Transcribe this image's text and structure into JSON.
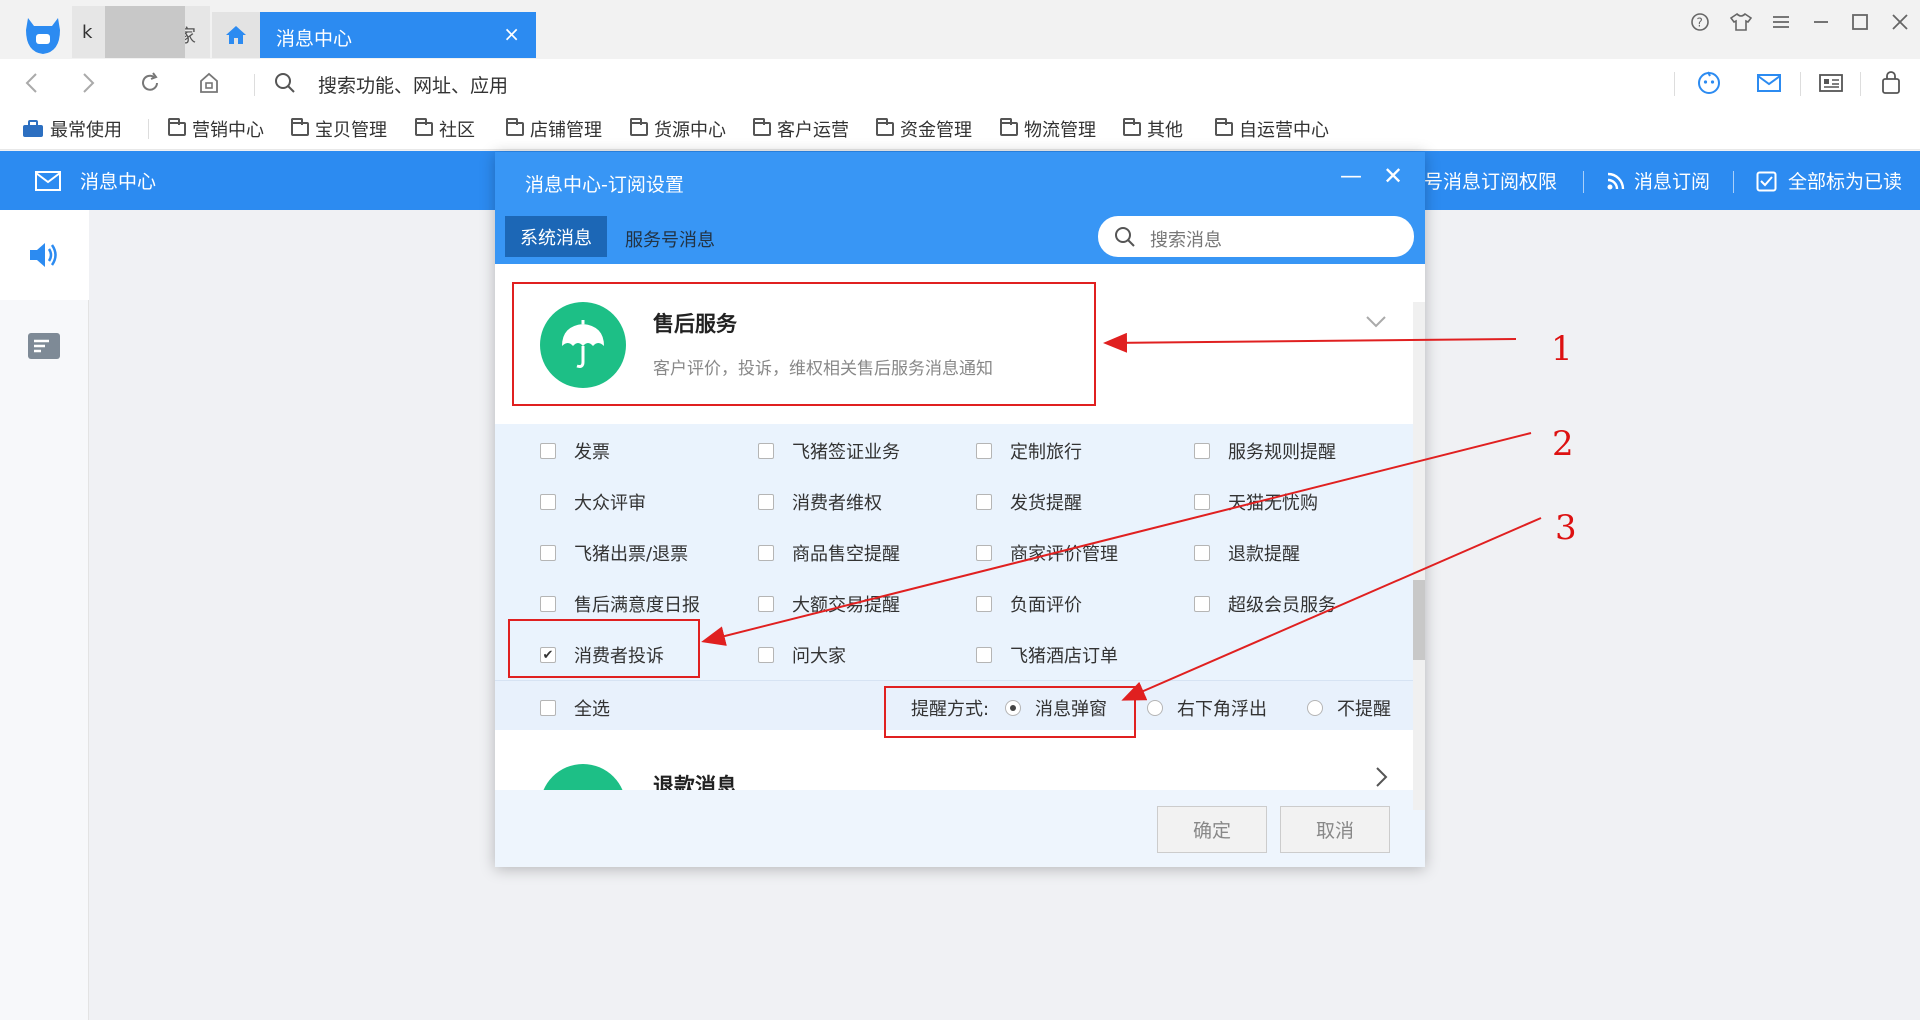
{
  "window": {
    "tabs": [
      {
        "label_prefix": "k",
        "label_suffix": "家"
      },
      {
        "label": "消息中心",
        "close": "×"
      }
    ],
    "controls": [
      "help",
      "skin",
      "menu",
      "minimize",
      "maximize",
      "close"
    ]
  },
  "nav": {
    "search_placeholder": "搜索功能、网址、应用"
  },
  "bookmarks": {
    "favorites": "最常使用",
    "items": [
      "营销中心",
      "宝贝管理",
      "社区",
      "店铺管理",
      "货源中心",
      "客户运营",
      "资金管理",
      "物流管理",
      "其他",
      "自运营中心"
    ]
  },
  "app_header": {
    "title": "消息中心",
    "actions": [
      "账号消息订阅权限",
      "消息订阅",
      "全部标为已读"
    ]
  },
  "dialog": {
    "title": "消息中心-订阅设置",
    "tabs": [
      "系统消息",
      "服务号消息"
    ],
    "search_placeholder": "搜索消息",
    "section": {
      "title": "售后服务",
      "description": "客户评价，投诉，维权相关售后服务消息通知"
    },
    "checkboxes": [
      {
        "label": "发票",
        "checked": false
      },
      {
        "label": "飞猪签证业务",
        "checked": false
      },
      {
        "label": "定制旅行",
        "checked": false
      },
      {
        "label": "服务规则提醒",
        "checked": false
      },
      {
        "label": "大众评审",
        "checked": false
      },
      {
        "label": "消费者维权",
        "checked": false
      },
      {
        "label": "发货提醒",
        "checked": false
      },
      {
        "label": "天猫无忧购",
        "checked": false
      },
      {
        "label": "飞猪出票/退票",
        "checked": false
      },
      {
        "label": "商品售空提醒",
        "checked": false
      },
      {
        "label": "商家评价管理",
        "checked": false
      },
      {
        "label": "退款提醒",
        "checked": false
      },
      {
        "label": "售后满意度日报",
        "checked": false
      },
      {
        "label": "大额交易提醒",
        "checked": false
      },
      {
        "label": "负面评价",
        "checked": false
      },
      {
        "label": "超级会员服务",
        "checked": false
      },
      {
        "label": "消费者投诉",
        "checked": true
      },
      {
        "label": "问大家",
        "checked": false
      },
      {
        "label": "飞猪酒店订单",
        "checked": false
      }
    ],
    "select_all": "全选",
    "reminder": {
      "label": "提醒方式:",
      "options": [
        "消息弹窗",
        "右下角浮出",
        "不提醒"
      ],
      "selected": "消息弹窗"
    },
    "next_section": {
      "title": "退款消息"
    },
    "buttons": {
      "ok": "确定",
      "cancel": "取消"
    }
  },
  "annotations": [
    "1",
    "2",
    "3"
  ],
  "colors": {
    "accent": "#2c8bf1",
    "dialog_header": "#3896f5",
    "annotation": "#e02020",
    "icon_green": "#1dbf86"
  }
}
